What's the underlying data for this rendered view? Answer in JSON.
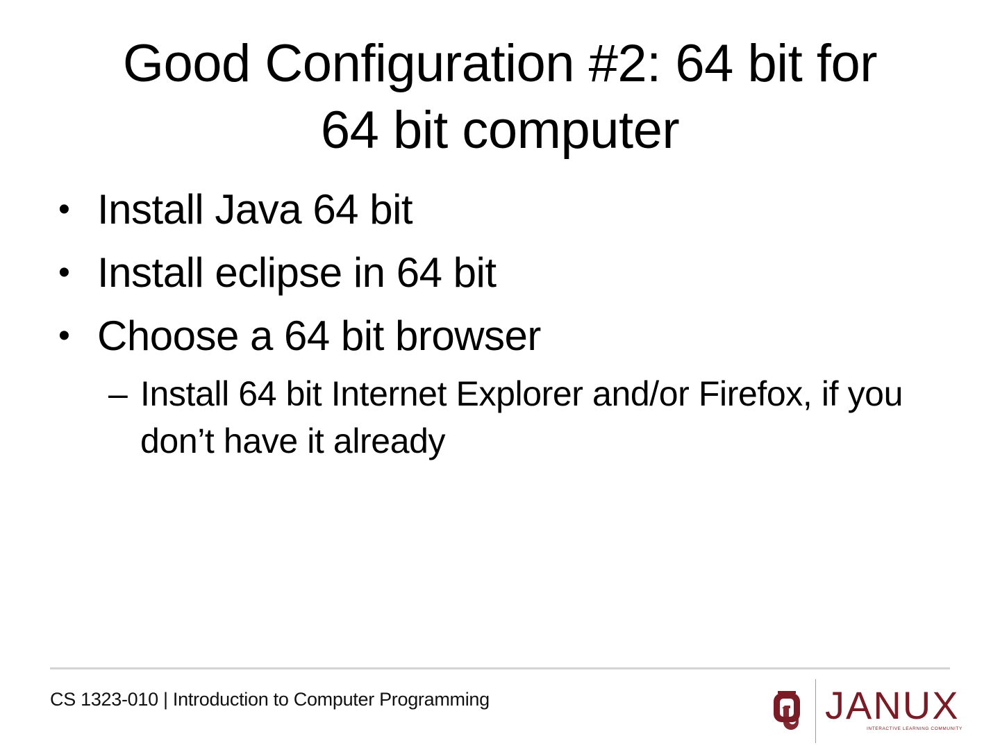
{
  "slide": {
    "title_lines": [
      "Good Configuration #2: 64 bit for",
      "64 bit computer"
    ],
    "bullets": [
      "Install Java 64 bit",
      "Install eclipse in 64 bit",
      "Choose a 64 bit browser"
    ],
    "sub_bullet_marker": "–",
    "bullet_marker": "•",
    "sub_bullets": [
      "Install 64 bit Internet Explorer and/or Firefox, if you don’t have it already"
    ]
  },
  "footer": {
    "course": "CS 1323-010 | Introduction to Computer Programming",
    "logo": {
      "wordmark": "JANUX",
      "tagline": "INTERACTIVE LEARNING COMMUNITY",
      "brand_color": "#7a1c26",
      "emblem_icon": "ou-interlocking-logo-icon"
    }
  }
}
